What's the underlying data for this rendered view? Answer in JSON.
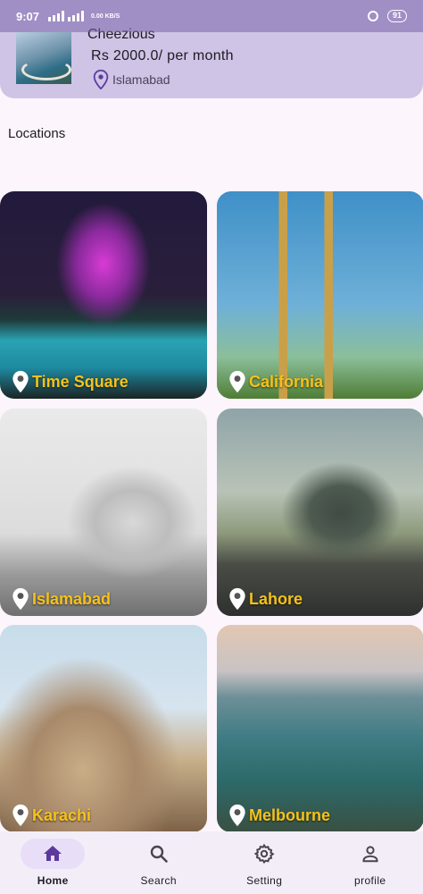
{
  "status_bar": {
    "time": "9:07",
    "network_speed": "0.00 KB/S",
    "battery": "91"
  },
  "top_card": {
    "name": "Cheezious",
    "price": "Rs 2000.0/ per month",
    "location": "Islamabad"
  },
  "section_title": "Locations",
  "locations": [
    {
      "label": "Time Square"
    },
    {
      "label": "California"
    },
    {
      "label": "Islamabad"
    },
    {
      "label": "Lahore"
    },
    {
      "label": "Karachi"
    },
    {
      "label": "Melbourne"
    }
  ],
  "bottom_nav": {
    "items": [
      {
        "label": "Home",
        "icon": "home-icon",
        "active": true
      },
      {
        "label": "Search",
        "icon": "search-icon",
        "active": false
      },
      {
        "label": "Setting",
        "icon": "gear-icon",
        "active": false
      },
      {
        "label": "profile",
        "icon": "person-icon",
        "active": false
      }
    ]
  },
  "colors": {
    "accent": "#5B3A9E",
    "label_yellow": "#F6C21A",
    "card_background": "#CFC3E6",
    "page_background": "#FCF5FC"
  }
}
